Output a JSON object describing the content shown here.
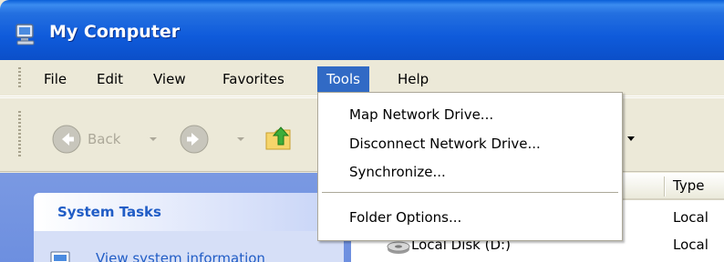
{
  "window": {
    "title": "My Computer",
    "icons": {
      "title": "my-computer-icon"
    }
  },
  "menubar": {
    "items": [
      {
        "label": "File"
      },
      {
        "label": "Edit"
      },
      {
        "label": "View"
      },
      {
        "label": "Favorites"
      },
      {
        "label": "Tools",
        "active": true
      },
      {
        "label": "Help"
      }
    ]
  },
  "toolbar": {
    "back_label": "Back",
    "icons": [
      "back-arrow-icon",
      "forward-arrow-icon",
      "up-folder-icon"
    ]
  },
  "tools_menu": {
    "items": [
      {
        "label": "Map Network Drive..."
      },
      {
        "label": "Disconnect Network Drive..."
      },
      {
        "label": "Synchronize..."
      },
      {
        "label": "Folder Options..."
      }
    ]
  },
  "task_pane": {
    "system_tasks_title": "System Tasks",
    "items": [
      {
        "label": "View system information",
        "icon": "system-info-icon"
      }
    ]
  },
  "file_list": {
    "column_type": "Type",
    "rows": [
      {
        "name": "",
        "type": "Local"
      },
      {
        "name": "Local Disk (D:)",
        "type": "Local"
      }
    ]
  },
  "colors": {
    "titlebar": "#0F5BDB",
    "menu_highlight": "#316AC5",
    "task_pane": "#7A99E2",
    "task_link": "#215DC6",
    "window_bg": "#ECE9D8"
  }
}
